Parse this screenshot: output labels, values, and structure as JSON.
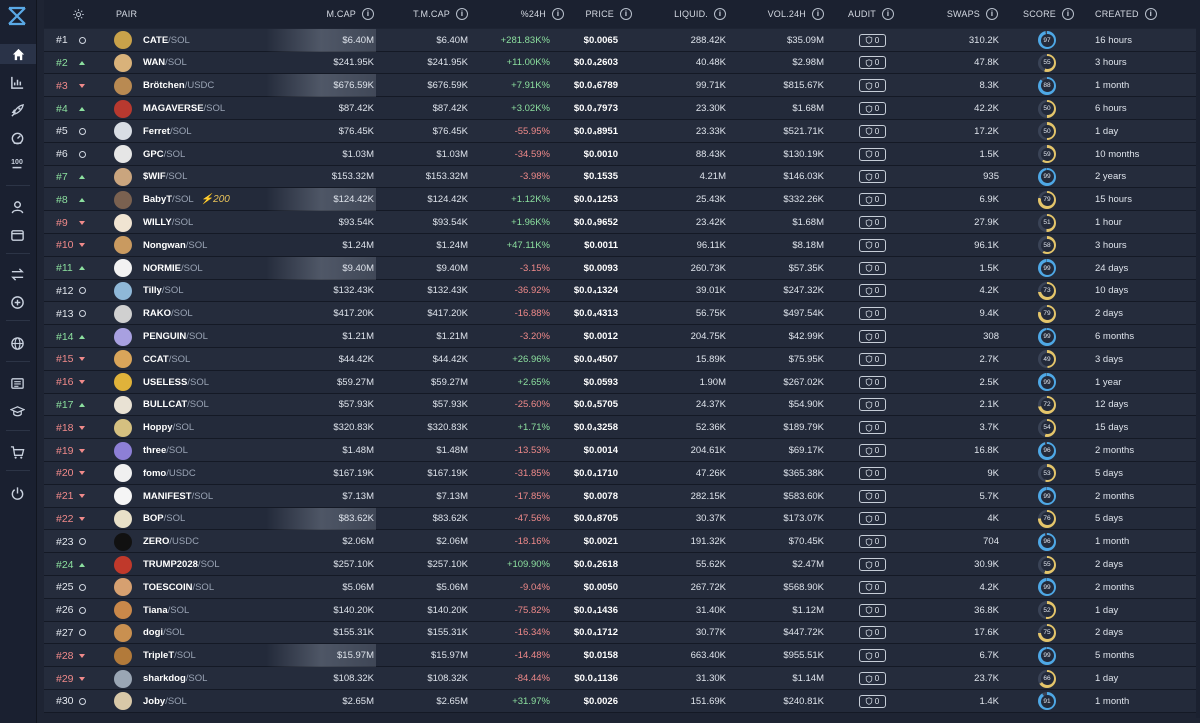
{
  "header": {
    "pair": "PAIR",
    "mcap": "M.CAP",
    "tmcap": "T.M.CAP",
    "change": "%24H",
    "price": "PRICE",
    "liquidity": "LIQUID.",
    "volume": "VOL.24H",
    "audit": "AUDIT",
    "swaps": "SWAPS",
    "score": "SCORE",
    "created": "CREATED"
  },
  "colors": {
    "background": "#1e2433",
    "positive": "#8ce09f",
    "negative": "#f08a8a",
    "accent": "#4ea8e6"
  },
  "rows": [
    {
      "rank": "#1",
      "trend": "flat",
      "name": "CATE",
      "quote": "SOL",
      "mcap": "$6.40M",
      "tmcap": "$6.40M",
      "change": "+281.83K%",
      "price": "$0.0065",
      "liquidity": "288.42K",
      "volume": "$35.09M",
      "audit": "0",
      "swaps": "310.2K",
      "score": "97",
      "score_color": "#4ea8e6",
      "created": "16 hours",
      "avatar_color": "#c9a24a",
      "banner": true
    },
    {
      "rank": "#2",
      "trend": "up",
      "name": "WAN",
      "quote": "SOL",
      "mcap": "$241.95K",
      "tmcap": "$241.95K",
      "change": "+11.00K%",
      "price": "$0.0₄2603",
      "liquidity": "40.48K",
      "volume": "$2.98M",
      "audit": "0",
      "swaps": "47.8K",
      "score": "55",
      "score_color": "#e4c56a",
      "created": "3 hours",
      "avatar_color": "#d9b27a"
    },
    {
      "rank": "#3",
      "trend": "down",
      "name": "Brötchen",
      "quote": "USDC",
      "mcap": "$676.59K",
      "tmcap": "$676.59K",
      "change": "+7.91K%",
      "price": "$0.0₄6789",
      "liquidity": "99.71K",
      "volume": "$815.67K",
      "audit": "0",
      "swaps": "8.3K",
      "score": "88",
      "score_color": "#4ea8e6",
      "created": "1 month",
      "avatar_color": "#b98a52",
      "banner": true
    },
    {
      "rank": "#4",
      "trend": "up",
      "name": "MAGAVERSE",
      "quote": "SOL",
      "mcap": "$87.42K",
      "tmcap": "$87.42K",
      "change": "+3.02K%",
      "price": "$0.0₄7973",
      "liquidity": "23.30K",
      "volume": "$1.68M",
      "audit": "0",
      "swaps": "42.2K",
      "score": "50",
      "score_color": "#e4c56a",
      "created": "6 hours",
      "avatar_color": "#b8392f"
    },
    {
      "rank": "#5",
      "trend": "flat",
      "name": "Ferret",
      "quote": "SOL",
      "mcap": "$76.45K",
      "tmcap": "$76.45K",
      "change": "-55.95%",
      "price": "$0.0₄8951",
      "liquidity": "23.33K",
      "volume": "$521.71K",
      "audit": "0",
      "swaps": "17.2K",
      "score": "50",
      "score_color": "#e4c56a",
      "created": "1 day",
      "avatar_color": "#d8dde4"
    },
    {
      "rank": "#6",
      "trend": "flat",
      "name": "GPC",
      "quote": "SOL",
      "mcap": "$1.03M",
      "tmcap": "$1.03M",
      "change": "-34.59%",
      "price": "$0.0010",
      "liquidity": "88.43K",
      "volume": "$130.19K",
      "audit": "0",
      "swaps": "1.5K",
      "score": "59",
      "score_color": "#e4c56a",
      "created": "10 months",
      "avatar_color": "#e6e6e6"
    },
    {
      "rank": "#7",
      "trend": "up",
      "name": "$WIF",
      "quote": "SOL",
      "mcap": "$153.32M",
      "tmcap": "$153.32M",
      "change": "-3.98%",
      "price": "$0.1535",
      "liquidity": "4.21M",
      "volume": "$146.03K",
      "audit": "0",
      "swaps": "935",
      "score": "99",
      "score_color": "#4ea8e6",
      "created": "2 years",
      "avatar_color": "#caa57e"
    },
    {
      "rank": "#8",
      "trend": "up",
      "name": "BabyT",
      "quote": "SOL",
      "boost": "⚡200",
      "mcap": "$124.42K",
      "tmcap": "$124.42K",
      "change": "+1.12K%",
      "price": "$0.0₄1253",
      "liquidity": "25.43K",
      "volume": "$332.26K",
      "audit": "0",
      "swaps": "6.9K",
      "score": "79",
      "score_color": "#e4c56a",
      "created": "15 hours",
      "avatar_color": "#7a6150",
      "banner": true
    },
    {
      "rank": "#9",
      "trend": "down",
      "name": "WILLY",
      "quote": "SOL",
      "mcap": "$93.54K",
      "tmcap": "$93.54K",
      "change": "+1.96K%",
      "price": "$0.0₄9652",
      "liquidity": "23.42K",
      "volume": "$1.68M",
      "audit": "0",
      "swaps": "27.9K",
      "score": "51",
      "score_color": "#e4c56a",
      "created": "1 hour",
      "avatar_color": "#f0e4d2"
    },
    {
      "rank": "#10",
      "trend": "down",
      "name": "Nongwan",
      "quote": "SOL",
      "mcap": "$1.24M",
      "tmcap": "$1.24M",
      "change": "+47.11K%",
      "price": "$0.0011",
      "liquidity": "96.11K",
      "volume": "$8.18M",
      "audit": "0",
      "swaps": "96.1K",
      "score": "58",
      "score_color": "#e4c56a",
      "created": "3 hours",
      "avatar_color": "#c99a60"
    },
    {
      "rank": "#11",
      "trend": "up",
      "name": "NORMIE",
      "quote": "SOL",
      "mcap": "$9.40M",
      "tmcap": "$9.40M",
      "change": "-3.15%",
      "price": "$0.0093",
      "liquidity": "260.73K",
      "volume": "$57.35K",
      "audit": "0",
      "swaps": "1.5K",
      "score": "99",
      "score_color": "#4ea8e6",
      "created": "24 days",
      "avatar_color": "#f2f2f2",
      "banner": true
    },
    {
      "rank": "#12",
      "trend": "flat",
      "name": "Tilly",
      "quote": "SOL",
      "mcap": "$132.43K",
      "tmcap": "$132.43K",
      "change": "-36.92%",
      "price": "$0.0₄1324",
      "liquidity": "39.01K",
      "volume": "$247.32K",
      "audit": "0",
      "swaps": "4.2K",
      "score": "73",
      "score_color": "#e4c56a",
      "created": "10 days",
      "avatar_color": "#8fb8d8"
    },
    {
      "rank": "#13",
      "trend": "flat",
      "name": "RAKO",
      "quote": "SOL",
      "mcap": "$417.20K",
      "tmcap": "$417.20K",
      "change": "-16.88%",
      "price": "$0.0₄4313",
      "liquidity": "56.75K",
      "volume": "$497.54K",
      "audit": "0",
      "swaps": "9.4K",
      "score": "79",
      "score_color": "#e4c56a",
      "created": "2 days",
      "avatar_color": "#d0d0d0"
    },
    {
      "rank": "#14",
      "trend": "up",
      "name": "PENGUIN",
      "quote": "SOL",
      "mcap": "$1.21M",
      "tmcap": "$1.21M",
      "change": "-3.20%",
      "price": "$0.0012",
      "liquidity": "204.75K",
      "volume": "$42.99K",
      "audit": "0",
      "swaps": "308",
      "score": "99",
      "score_color": "#4ea8e6",
      "created": "6 months",
      "avatar_color": "#a8a0e0"
    },
    {
      "rank": "#15",
      "trend": "down",
      "name": "CCAT",
      "quote": "SOL",
      "mcap": "$44.42K",
      "tmcap": "$44.42K",
      "change": "+26.96%",
      "price": "$0.0₄4507",
      "liquidity": "15.89K",
      "volume": "$75.95K",
      "audit": "0",
      "swaps": "2.7K",
      "score": "49",
      "score_color": "#e4c56a",
      "created": "3 days",
      "avatar_color": "#d9a55a"
    },
    {
      "rank": "#16",
      "trend": "down",
      "name": "USELESS",
      "quote": "SOL",
      "mcap": "$59.27M",
      "tmcap": "$59.27M",
      "change": "+2.65%",
      "price": "$0.0593",
      "liquidity": "1.90M",
      "volume": "$267.02K",
      "audit": "0",
      "swaps": "2.5K",
      "score": "99",
      "score_color": "#4ea8e6",
      "created": "1 year",
      "avatar_color": "#e0b23a"
    },
    {
      "rank": "#17",
      "trend": "up",
      "name": "BULLCAT",
      "quote": "SOL",
      "mcap": "$57.93K",
      "tmcap": "$57.93K",
      "change": "-25.60%",
      "price": "$0.0₄5705",
      "liquidity": "24.37K",
      "volume": "$54.90K",
      "audit": "0",
      "swaps": "2.1K",
      "score": "72",
      "score_color": "#e4c56a",
      "created": "12 days",
      "avatar_color": "#e9e2d4"
    },
    {
      "rank": "#18",
      "trend": "down",
      "name": "Hoppy",
      "quote": "SOL",
      "mcap": "$320.83K",
      "tmcap": "$320.83K",
      "change": "+1.71%",
      "price": "$0.0₄3258",
      "liquidity": "52.36K",
      "volume": "$189.79K",
      "audit": "0",
      "swaps": "3.7K",
      "score": "54",
      "score_color": "#e4c56a",
      "created": "15 days",
      "avatar_color": "#d5c080"
    },
    {
      "rank": "#19",
      "trend": "down",
      "name": "three",
      "quote": "SOL",
      "mcap": "$1.48M",
      "tmcap": "$1.48M",
      "change": "-13.53%",
      "price": "$0.0014",
      "liquidity": "204.61K",
      "volume": "$69.17K",
      "audit": "0",
      "swaps": "16.8K",
      "score": "96",
      "score_color": "#4ea8e6",
      "created": "2 months",
      "avatar_color": "#8d7fd6"
    },
    {
      "rank": "#20",
      "trend": "down",
      "name": "fomo",
      "quote": "USDC",
      "mcap": "$167.19K",
      "tmcap": "$167.19K",
      "change": "-31.85%",
      "price": "$0.0₄1710",
      "liquidity": "47.26K",
      "volume": "$365.38K",
      "audit": "0",
      "swaps": "9K",
      "score": "53",
      "score_color": "#e4c56a",
      "created": "5 days",
      "avatar_color": "#f0f0f0"
    },
    {
      "rank": "#21",
      "trend": "down",
      "name": "MANIFEST",
      "quote": "SOL",
      "mcap": "$7.13M",
      "tmcap": "$7.13M",
      "change": "-17.85%",
      "price": "$0.0078",
      "liquidity": "282.15K",
      "volume": "$583.60K",
      "audit": "0",
      "swaps": "5.7K",
      "score": "99",
      "score_color": "#4ea8e6",
      "created": "2 months",
      "avatar_color": "#f5f5f5"
    },
    {
      "rank": "#22",
      "trend": "down",
      "name": "BOP",
      "quote": "SOL",
      "mcap": "$83.62K",
      "tmcap": "$83.62K",
      "change": "-47.56%",
      "price": "$0.0₄8705",
      "liquidity": "30.37K",
      "volume": "$173.07K",
      "audit": "0",
      "swaps": "4K",
      "score": "76",
      "score_color": "#e4c56a",
      "created": "5 days",
      "avatar_color": "#e8e0c8",
      "banner": true
    },
    {
      "rank": "#23",
      "trend": "flat",
      "name": "ZERO",
      "quote": "USDC",
      "mcap": "$2.06M",
      "tmcap": "$2.06M",
      "change": "-18.16%",
      "price": "$0.0021",
      "liquidity": "191.32K",
      "volume": "$70.45K",
      "audit": "0",
      "swaps": "704",
      "score": "96",
      "score_color": "#4ea8e6",
      "created": "1 month",
      "avatar_color": "#111111"
    },
    {
      "rank": "#24",
      "trend": "up",
      "name": "TRUMP2028",
      "quote": "SOL",
      "mcap": "$257.10K",
      "tmcap": "$257.10K",
      "change": "+109.90%",
      "price": "$0.0₄2618",
      "liquidity": "55.62K",
      "volume": "$2.47M",
      "audit": "0",
      "swaps": "30.9K",
      "score": "55",
      "score_color": "#e4c56a",
      "created": "2 days",
      "avatar_color": "#c0392b"
    },
    {
      "rank": "#25",
      "trend": "flat",
      "name": "TOESCOIN",
      "quote": "SOL",
      "mcap": "$5.06M",
      "tmcap": "$5.06M",
      "change": "-9.04%",
      "price": "$0.0050",
      "liquidity": "267.72K",
      "volume": "$568.90K",
      "audit": "0",
      "swaps": "4.2K",
      "score": "99",
      "score_color": "#4ea8e6",
      "created": "2 months",
      "avatar_color": "#d6a070"
    },
    {
      "rank": "#26",
      "trend": "flat",
      "name": "Tiana",
      "quote": "SOL",
      "mcap": "$140.20K",
      "tmcap": "$140.20K",
      "change": "-75.82%",
      "price": "$0.0₄1436",
      "liquidity": "31.40K",
      "volume": "$1.12M",
      "audit": "0",
      "swaps": "36.8K",
      "score": "52",
      "score_color": "#e4c56a",
      "created": "1 day",
      "avatar_color": "#c9884a"
    },
    {
      "rank": "#27",
      "trend": "flat",
      "name": "dogi",
      "quote": "SOL",
      "mcap": "$155.31K",
      "tmcap": "$155.31K",
      "change": "-16.34%",
      "price": "$0.0₄1712",
      "liquidity": "30.77K",
      "volume": "$447.72K",
      "audit": "0",
      "swaps": "17.6K",
      "score": "75",
      "score_color": "#e4c56a",
      "created": "2 days",
      "avatar_color": "#c99050"
    },
    {
      "rank": "#28",
      "trend": "down",
      "name": "TripleT",
      "quote": "SOL",
      "mcap": "$15.97M",
      "tmcap": "$15.97M",
      "change": "-14.48%",
      "price": "$0.0158",
      "liquidity": "663.40K",
      "volume": "$955.51K",
      "audit": "0",
      "swaps": "6.7K",
      "score": "99",
      "score_color": "#4ea8e6",
      "created": "5 months",
      "avatar_color": "#b27a3a",
      "banner": true
    },
    {
      "rank": "#29",
      "trend": "down",
      "name": "sharkdog",
      "quote": "SOL",
      "mcap": "$108.32K",
      "tmcap": "$108.32K",
      "change": "-84.44%",
      "price": "$0.0₄1136",
      "liquidity": "31.30K",
      "volume": "$1.14M",
      "audit": "0",
      "swaps": "23.7K",
      "score": "66",
      "score_color": "#e4c56a",
      "created": "1 day",
      "avatar_color": "#9aa6b4"
    },
    {
      "rank": "#30",
      "trend": "flat",
      "name": "Joby",
      "quote": "SOL",
      "mcap": "$2.65M",
      "tmcap": "$2.65M",
      "change": "+31.97%",
      "price": "$0.0026",
      "liquidity": "151.69K",
      "volume": "$240.81K",
      "audit": "0",
      "swaps": "1.4K",
      "score": "91",
      "score_color": "#4ea8e6",
      "created": "1 month",
      "avatar_color": "#d8c8a8"
    }
  ]
}
